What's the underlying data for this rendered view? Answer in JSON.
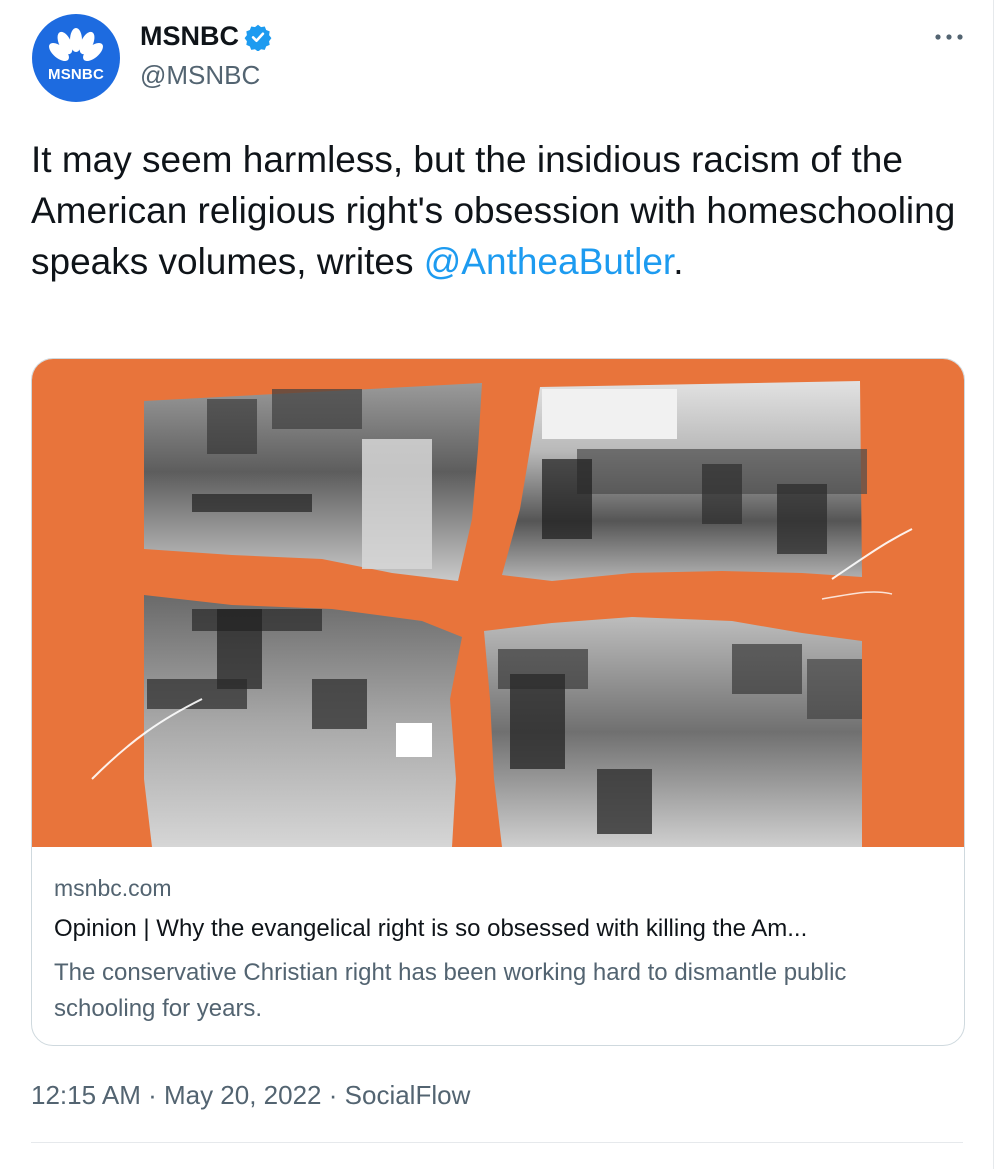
{
  "author": {
    "display_name": "MSNBC",
    "handle": "@MSNBC",
    "avatar_text": "MSNBC",
    "verified": true,
    "avatar_color": "#1d6be0"
  },
  "tweet": {
    "text": "It may seem harmless, but the insidious racism of the American religious right's obsession with homeschooling speaks volumes, writes ",
    "mention": "@AntheaButler",
    "text_end": "."
  },
  "card": {
    "image_alt": "Black-and-white classroom photo torn into four pieces on an orange background",
    "domain": "msnbc.com",
    "title": "Opinion | Why the evangelical right is so obsessed with killing the Am...",
    "description": "The conservative Christian right has been working hard to dismantle public schooling for years.",
    "background_color": "#e8743b"
  },
  "meta": {
    "time": "12:15 AM",
    "date": "May 20, 2022",
    "source": "SocialFlow",
    "separator": " · "
  },
  "colors": {
    "link": "#1d9bf0",
    "secondary_text": "#536471",
    "primary_text": "#0f1419"
  },
  "icons": {
    "verified": "verified-badge-icon",
    "more": "more-dots-icon",
    "logo": "peacock-logo-icon"
  }
}
